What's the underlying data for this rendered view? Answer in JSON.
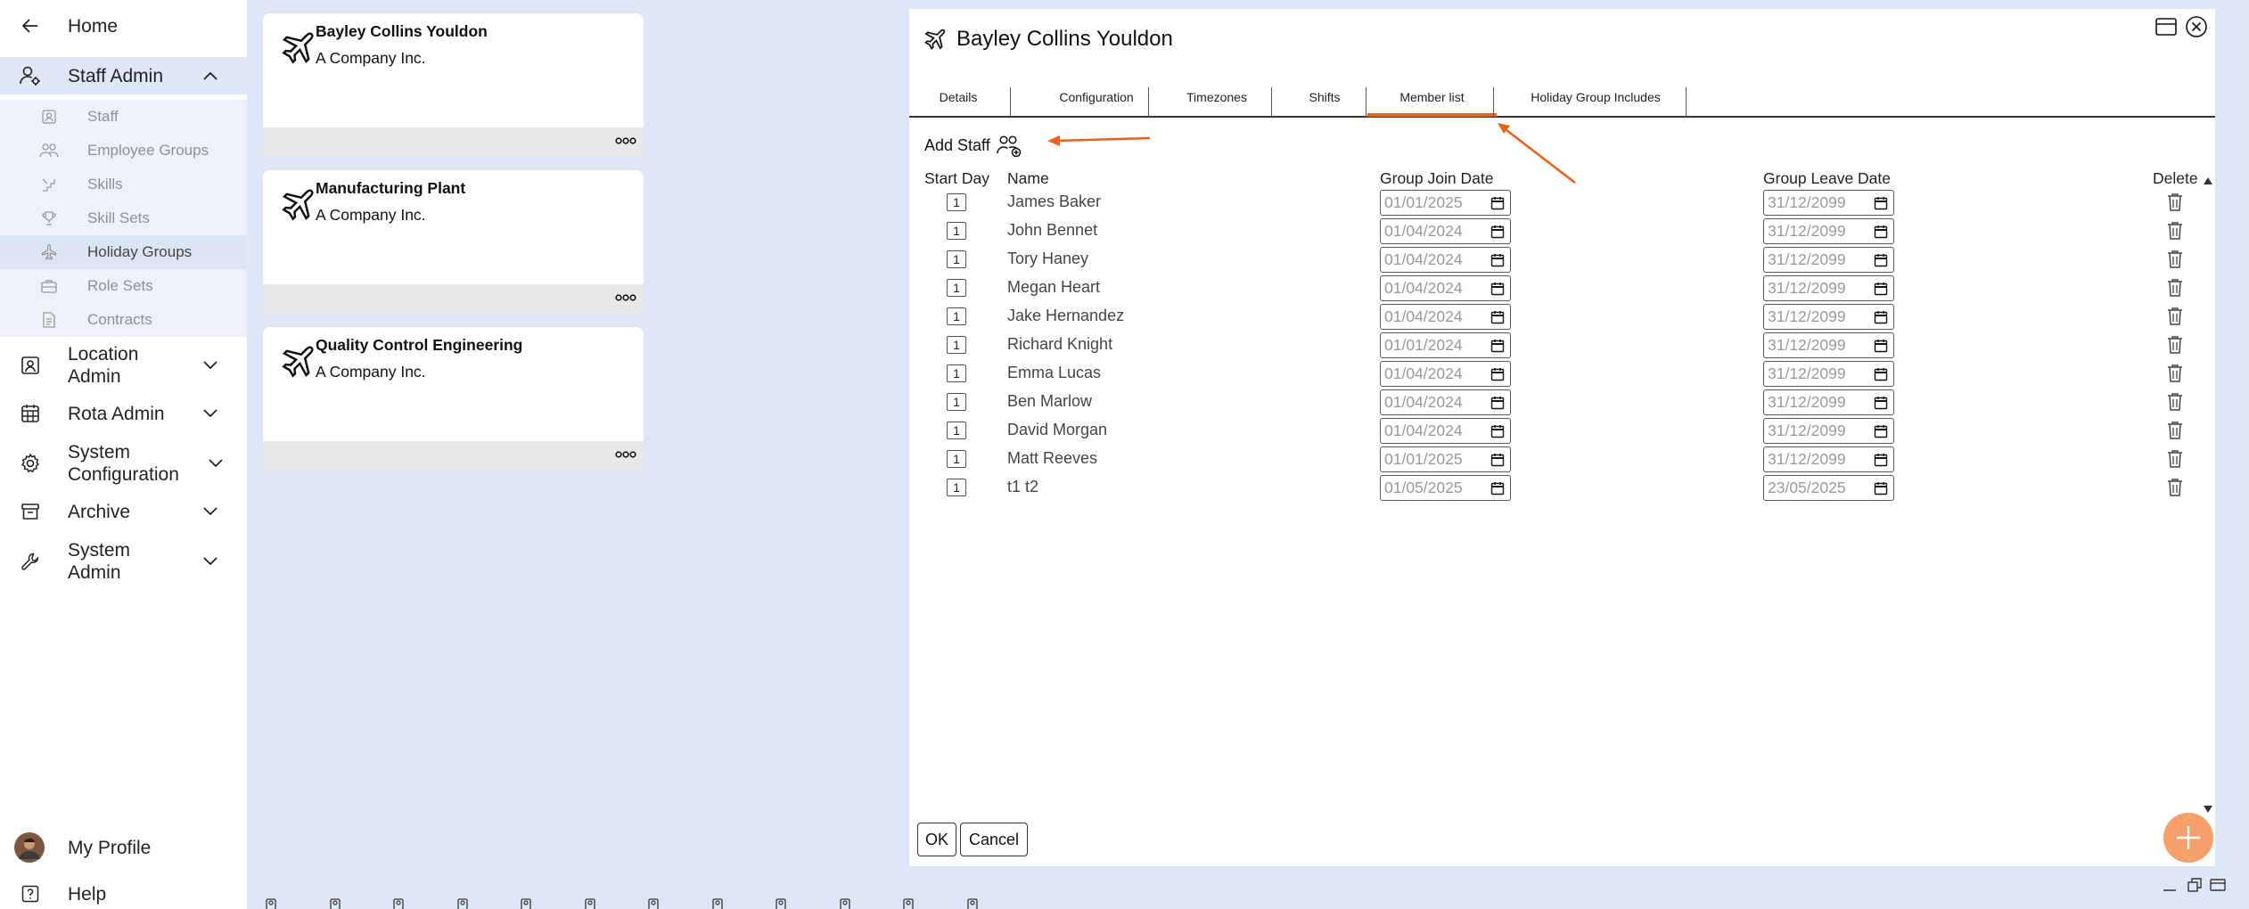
{
  "sidebar": {
    "home": "Home",
    "staff_admin": "Staff Admin",
    "sub_items": [
      {
        "label": "Staff",
        "icon": "person-badge-icon"
      },
      {
        "label": "Employee Groups",
        "icon": "people-icon"
      },
      {
        "label": "Skills",
        "icon": "stairs-icon"
      },
      {
        "label": "Skill Sets",
        "icon": "trophy-icon"
      },
      {
        "label": "Holiday Groups",
        "icon": "plane-icon"
      },
      {
        "label": "Role Sets",
        "icon": "briefcase-icon"
      },
      {
        "label": "Contracts",
        "icon": "document-icon"
      }
    ],
    "location_admin": "Location Admin",
    "rota_admin": "Rota Admin",
    "system_configuration": "System Configuration",
    "archive": "Archive",
    "system_admin": "System Admin",
    "my_profile": "My Profile",
    "help": "Help"
  },
  "cards": [
    {
      "title": "Bayley Collins Youldon",
      "company": "A Company Inc."
    },
    {
      "title": "Manufacturing Plant",
      "company": "A Company Inc."
    },
    {
      "title": "Quality Control Engineering",
      "company": "A Company Inc."
    }
  ],
  "dialog": {
    "title": "Bayley Collins Youldon",
    "tabs": [
      "Details",
      "Configuration",
      "Timezones",
      "Shifts",
      "Member list",
      "Holiday Group Includes"
    ],
    "active_tab": "Member list",
    "add_staff": "Add Staff",
    "columns": {
      "start_day": "Start Day",
      "name": "Name",
      "join": "Group Join Date",
      "leave": "Group Leave Date",
      "delete": "Delete"
    },
    "rows": [
      {
        "start_day": "1",
        "name": "James Baker",
        "join": "01/01/2025",
        "leave": "31/12/2099"
      },
      {
        "start_day": "1",
        "name": "John Bennet",
        "join": "01/04/2024",
        "leave": "31/12/2099"
      },
      {
        "start_day": "1",
        "name": "Tory Haney",
        "join": "01/04/2024",
        "leave": "31/12/2099"
      },
      {
        "start_day": "1",
        "name": "Megan Heart",
        "join": "01/04/2024",
        "leave": "31/12/2099"
      },
      {
        "start_day": "1",
        "name": "Jake Hernandez",
        "join": "01/04/2024",
        "leave": "31/12/2099"
      },
      {
        "start_day": "1",
        "name": "Richard Knight",
        "join": "01/01/2024",
        "leave": "31/12/2099"
      },
      {
        "start_day": "1",
        "name": "Emma Lucas",
        "join": "01/04/2024",
        "leave": "31/12/2099"
      },
      {
        "start_day": "1",
        "name": "Ben Marlow",
        "join": "01/04/2024",
        "leave": "31/12/2099"
      },
      {
        "start_day": "1",
        "name": "David Morgan",
        "join": "01/04/2024",
        "leave": "31/12/2099"
      },
      {
        "start_day": "1",
        "name": "Matt Reeves",
        "join": "01/01/2025",
        "leave": "31/12/2099"
      },
      {
        "start_day": "1",
        "name": "t1 t2",
        "join": "01/05/2025",
        "leave": "23/05/2025"
      }
    ],
    "ok": "OK",
    "cancel": "Cancel"
  },
  "colors": {
    "accent": "#e8621d",
    "fab": "#f5a06a",
    "background": "#dfe6f5"
  }
}
